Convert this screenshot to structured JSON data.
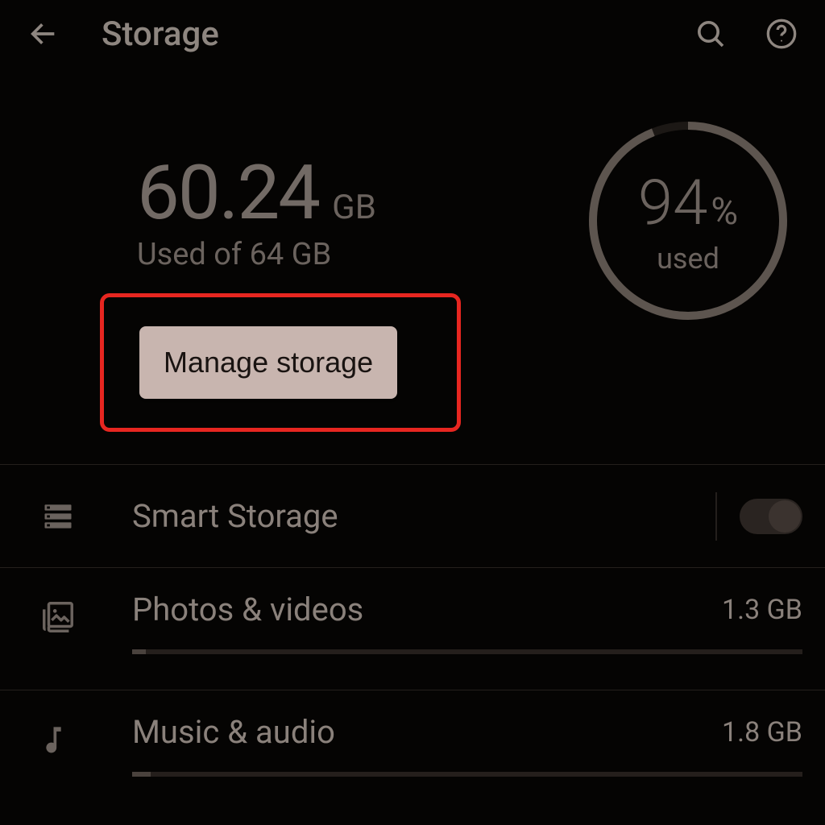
{
  "header": {
    "title": "Storage"
  },
  "summary": {
    "used_value": "60.24",
    "used_unit": "GB",
    "used_of": "Used of 64 GB",
    "manage_label": "Manage storage",
    "percent_value": "94",
    "percent_symbol": "%",
    "percent_label": "used",
    "percent_fraction": 0.94
  },
  "smart_storage": {
    "label": "Smart Storage",
    "enabled": true
  },
  "categories": [
    {
      "icon": "photo",
      "label": "Photos & videos",
      "size": "1.3 GB",
      "fraction": 0.02
    },
    {
      "icon": "music",
      "label": "Music & audio",
      "size": "1.8 GB",
      "fraction": 0.028
    }
  ]
}
